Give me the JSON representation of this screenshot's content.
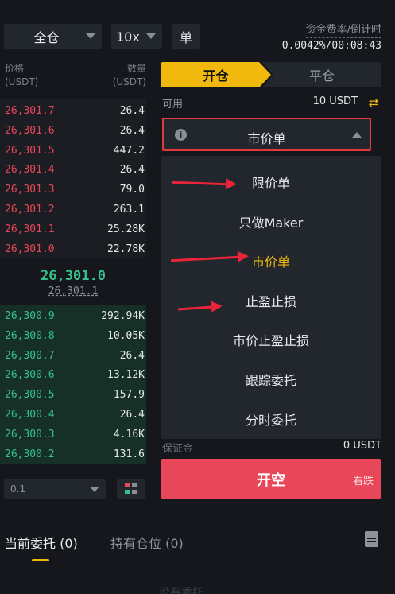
{
  "header": {
    "margin_mode": "全仓",
    "leverage": "10x",
    "position_mode": "单",
    "funding_label": "资金费率/倒计时",
    "funding_value": "0.0042%/00:08:43"
  },
  "orderbook": {
    "price_header_1": "价格",
    "price_header_2": "(USDT)",
    "qty_header_1": "数量",
    "qty_header_2": "(USDT)",
    "asks": [
      {
        "price": "26,301.7",
        "qty": "26.4"
      },
      {
        "price": "26,301.6",
        "qty": "26.4"
      },
      {
        "price": "26,301.5",
        "qty": "447.2"
      },
      {
        "price": "26,301.4",
        "qty": "26.4"
      },
      {
        "price": "26,301.3",
        "qty": "79.0"
      },
      {
        "price": "26,301.2",
        "qty": "263.1"
      },
      {
        "price": "26,301.1",
        "qty": "25.28K"
      },
      {
        "price": "26,301.0",
        "qty": "22.78K"
      }
    ],
    "last_price": "26,301.0",
    "mark_price": "26,301.1",
    "bids": [
      {
        "price": "26,300.9",
        "qty": "292.94K"
      },
      {
        "price": "26,300.8",
        "qty": "10.05K"
      },
      {
        "price": "26,300.7",
        "qty": "26.4"
      },
      {
        "price": "26,300.6",
        "qty": "13.12K"
      },
      {
        "price": "26,300.5",
        "qty": "157.9"
      },
      {
        "price": "26,300.4",
        "qty": "26.4"
      },
      {
        "price": "26,300.3",
        "qty": "4.16K"
      },
      {
        "price": "26,300.2",
        "qty": "131.6"
      }
    ],
    "precision": "0.1"
  },
  "trade": {
    "tab_open": "开仓",
    "tab_close": "平仓",
    "available_label": "可用",
    "available_value": "10 USDT",
    "order_type": "市价单",
    "order_types": [
      "限价单",
      "只做Maker",
      "市价单",
      "止盈止损",
      "市价止盈止损",
      "跟踪委托",
      "分时委托"
    ],
    "active_order_type_index": 2,
    "margin_label": "保证金",
    "margin_value": "0 USDT",
    "short_label": "开空",
    "short_sub": "看跌"
  },
  "bottom": {
    "tab_orders": "当前委托 (0)",
    "tab_positions": "持有仓位 (0)",
    "hint": "没有委托"
  },
  "colors": {
    "accent": "#f0b90b",
    "sell": "#e8475a",
    "buy": "#35c28a",
    "annotation": "#e8233a"
  }
}
